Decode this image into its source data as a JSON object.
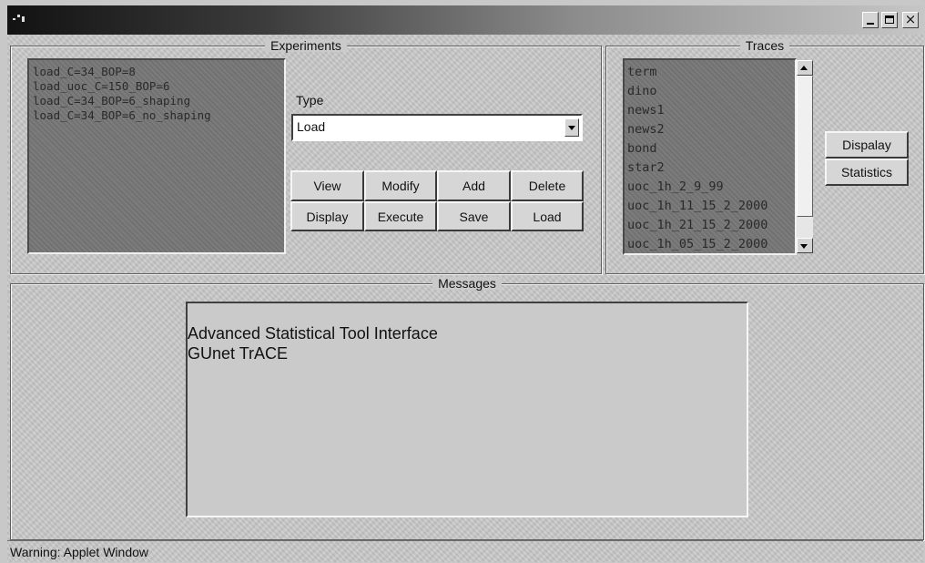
{
  "window": {
    "icon": "app-icon",
    "buttons": [
      "minimize-icon",
      "maximize-icon",
      "close-icon"
    ],
    "close_glyph": "×"
  },
  "experiments": {
    "legend": "Experiments",
    "items": [
      "load_C=34_BOP=8",
      "load_uoc_C=150_BOP=6",
      "load_C=34_BOP=6_shaping",
      "load_C=34_BOP=6_no_shaping"
    ],
    "type_label": "Type",
    "type_value": "Load",
    "buttons": {
      "view": "View",
      "modify": "Modify",
      "add": "Add",
      "delete": "Delete",
      "display": "Display",
      "execute": "Execute",
      "save": "Save",
      "load": "Load"
    }
  },
  "traces": {
    "legend": "Traces",
    "items": [
      "term",
      "dino",
      "news1",
      "news2",
      "bond",
      "star2",
      "uoc_1h_2_9_99",
      "uoc_1h_11_15_2_2000",
      "uoc_1h_21_15_2_2000",
      "uoc_1h_05_15_2_2000"
    ],
    "buttons": {
      "display": "Dispalay",
      "statistics": "Statistics"
    }
  },
  "messages": {
    "legend": "Messages",
    "lines": [
      "Advanced Statistical Tool Interface",
      "GUnet TrACE"
    ]
  },
  "status": {
    "text": "Warning: Applet Window"
  },
  "colors": {
    "list_bg": "#777777",
    "panel_bg": "#cacaca"
  }
}
